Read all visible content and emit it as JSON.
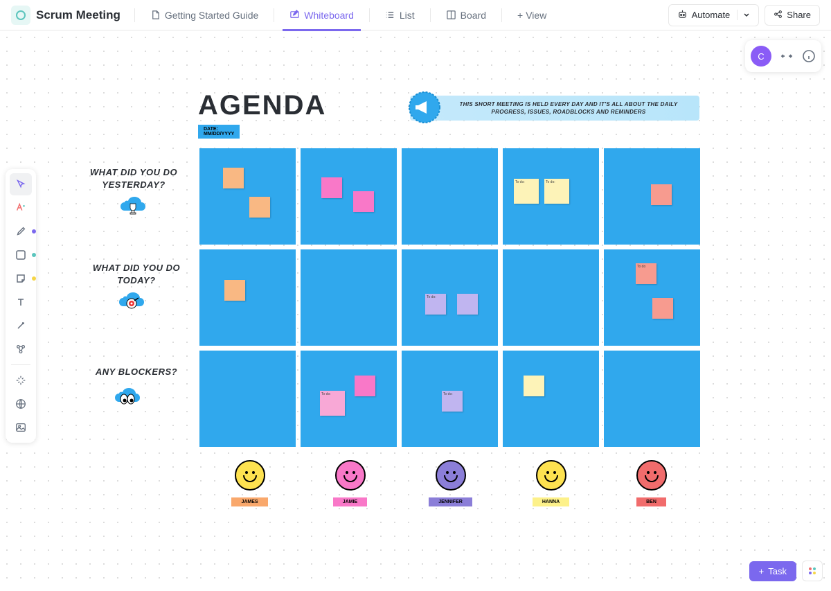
{
  "header": {
    "title": "Scrum Meeting",
    "tabs": [
      {
        "label": "Getting Started Guide",
        "active": false
      },
      {
        "label": "Whiteboard",
        "active": true
      },
      {
        "label": "List",
        "active": false
      },
      {
        "label": "Board",
        "active": false
      }
    ],
    "add_view": "View",
    "automate": "Automate",
    "share": "Share"
  },
  "avatar_letter": "C",
  "whiteboard": {
    "agenda_title": "AGENDA",
    "date_label": "DATE: MM/DD/YYYY",
    "banner_text": "THIS SHORT MEETING IS HELD EVERY DAY AND IT'S ALL ABOUT THE DAILY PROGRESS, ISSUES, ROADBLOCKS AND REMINDERS",
    "rows": [
      {
        "label": "WHAT DID YOU DO YESTERDAY?"
      },
      {
        "label": "WHAT DID YOU DO TODAY?"
      },
      {
        "label": "ANY BLOCKERS?"
      }
    ],
    "people": [
      {
        "name": "JAMES",
        "face_color": "#fee250",
        "tag_color": "#f9a86c"
      },
      {
        "name": "JAMIE",
        "face_color": "#f978c8",
        "tag_color": "#f978c8"
      },
      {
        "name": "JENNIFER",
        "face_color": "#8b7ed8",
        "tag_color": "#8b7ed8"
      },
      {
        "name": "HANNA",
        "face_color": "#fee250",
        "tag_color": "#fdf18a"
      },
      {
        "name": "BEN",
        "face_color": "#f16c6c",
        "tag_color": "#f16c6c"
      }
    ]
  },
  "task_button": "Task",
  "colors": {
    "accent": "#7b68ee",
    "cell_blue": "#30a8ed"
  }
}
